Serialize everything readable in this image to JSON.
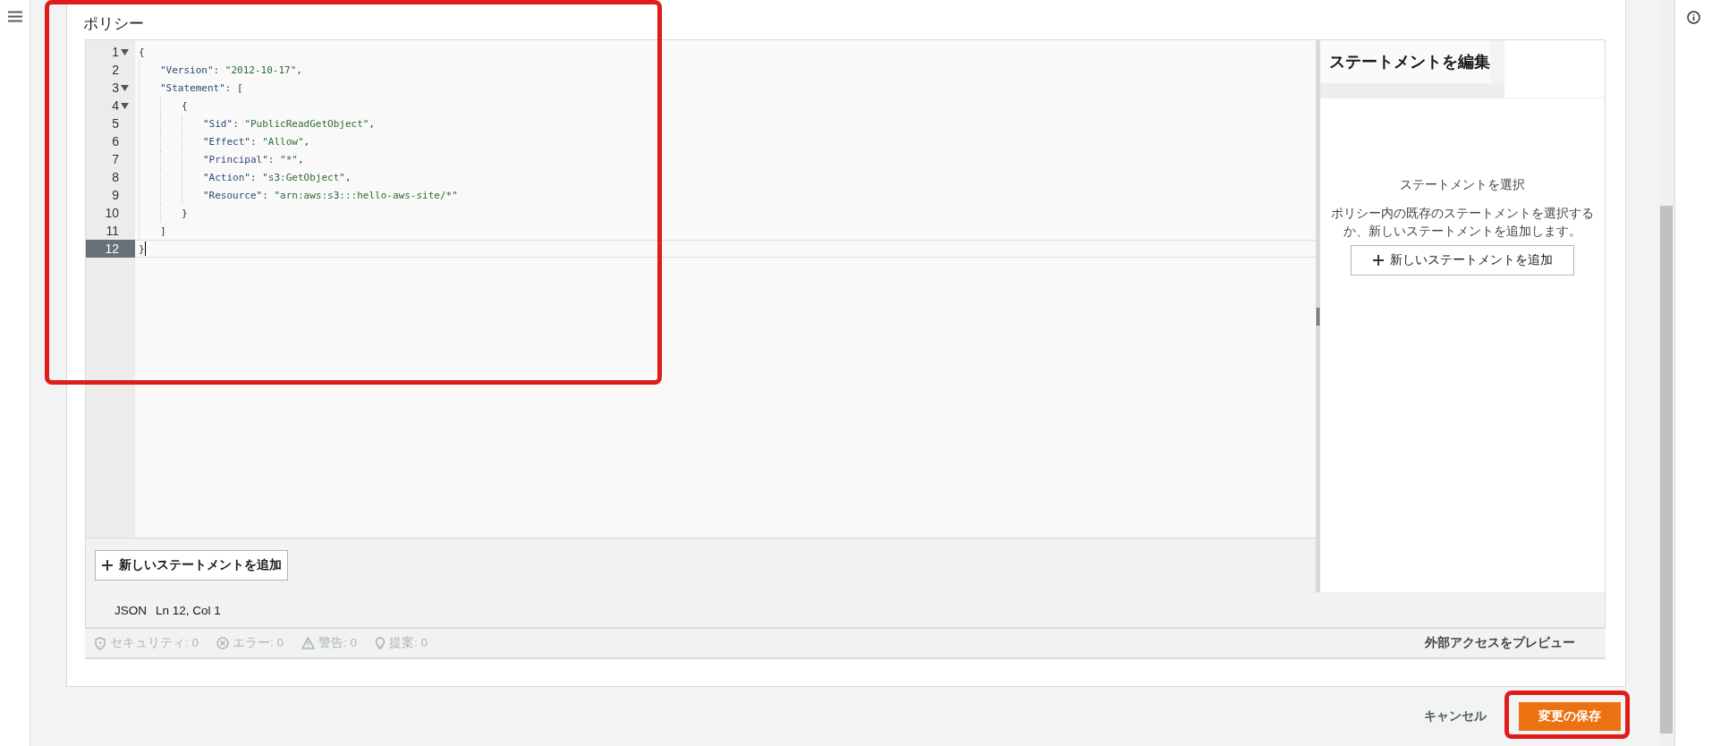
{
  "section_title": "ポリシー",
  "editor": {
    "lines": [
      {
        "number": "1",
        "fold": true,
        "active": false,
        "parts": [
          {
            "kind": "bracket",
            "text": "{"
          }
        ]
      },
      {
        "number": "2",
        "fold": false,
        "active": false,
        "parts": [
          {
            "kind": "key",
            "text": "\"Version\""
          },
          {
            "kind": "punct",
            "text": ": "
          },
          {
            "kind": "string",
            "text": "\"2012-10-17\""
          },
          {
            "kind": "punct",
            "text": ","
          }
        ]
      },
      {
        "number": "3",
        "fold": true,
        "active": false,
        "parts": [
          {
            "kind": "key",
            "text": "\"Statement\""
          },
          {
            "kind": "punct",
            "text": ": "
          },
          {
            "kind": "open",
            "text": "["
          }
        ]
      },
      {
        "number": "4",
        "fold": true,
        "active": false,
        "parts": [
          {
            "kind": "open",
            "text": "{"
          }
        ]
      },
      {
        "number": "5",
        "fold": false,
        "active": false,
        "parts": [
          {
            "kind": "key",
            "text": "\"Sid\""
          },
          {
            "kind": "punct",
            "text": ": "
          },
          {
            "kind": "string",
            "text": "\"PublicReadGetObject\""
          },
          {
            "kind": "punct",
            "text": ","
          }
        ]
      },
      {
        "number": "6",
        "fold": false,
        "active": false,
        "parts": [
          {
            "kind": "key",
            "text": "\"Effect\""
          },
          {
            "kind": "punct",
            "text": ": "
          },
          {
            "kind": "string",
            "text": "\"Allow\""
          },
          {
            "kind": "punct",
            "text": ","
          }
        ]
      },
      {
        "number": "7",
        "fold": false,
        "active": false,
        "parts": [
          {
            "kind": "key",
            "text": "\"Principal\""
          },
          {
            "kind": "punct",
            "text": ": "
          },
          {
            "kind": "string",
            "text": "\"*\""
          },
          {
            "kind": "punct",
            "text": ","
          }
        ]
      },
      {
        "number": "8",
        "fold": false,
        "active": false,
        "parts": [
          {
            "kind": "key",
            "text": "\"Action\""
          },
          {
            "kind": "punct",
            "text": ": "
          },
          {
            "kind": "string",
            "text": "\"s3:GetObject\""
          },
          {
            "kind": "punct",
            "text": ","
          }
        ]
      },
      {
        "number": "9",
        "fold": false,
        "active": false,
        "parts": [
          {
            "kind": "key",
            "text": "\"Resource\""
          },
          {
            "kind": "punct",
            "text": ": "
          },
          {
            "kind": "string",
            "text": "\"arn:aws:s3:::hello-aws-site/*\""
          }
        ]
      },
      {
        "number": "10",
        "fold": false,
        "active": false,
        "parts": [
          {
            "kind": "close",
            "text": "}"
          }
        ]
      },
      {
        "number": "11",
        "fold": false,
        "active": false,
        "parts": [
          {
            "kind": "close",
            "text": "]"
          }
        ]
      },
      {
        "number": "12",
        "fold": false,
        "active": true,
        "parts": [
          {
            "kind": "bracket",
            "text": "}"
          }
        ]
      }
    ],
    "add_statement_button": "新しいステートメントを追加",
    "status": {
      "language": "JSON",
      "position": "Ln 12, Col 1"
    },
    "issues": [
      {
        "kind": "security",
        "label": "セキュリティ: 0"
      },
      {
        "kind": "error",
        "label": "エラー: 0"
      },
      {
        "kind": "warning",
        "label": "警告: 0"
      },
      {
        "kind": "suggestion",
        "label": "提案: 0"
      }
    ],
    "preview_link": "外部アクセスをプレビュー"
  },
  "statement_panel": {
    "title": "ステートメントを編集",
    "empty_title": "ステートメントを選択",
    "empty_text": "ポリシー内の既存のステートメントを選択するか、新しいステートメントを追加します。",
    "add_button": "新しいステートメントを追加"
  },
  "footer": {
    "cancel": "キャンセル",
    "save": "変更の保存"
  },
  "highlights": {
    "editor": true,
    "save_button": true
  }
}
